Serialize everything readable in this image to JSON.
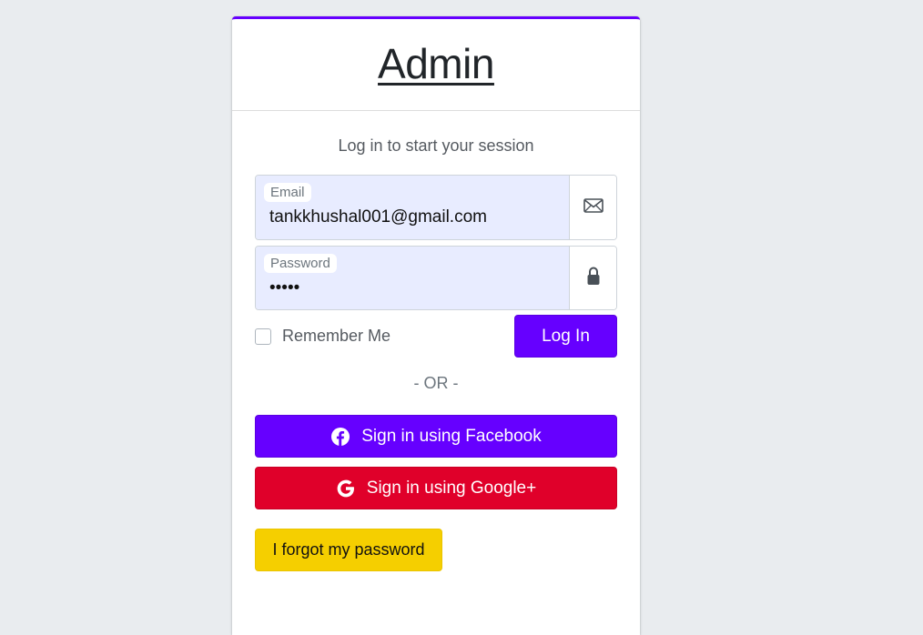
{
  "brand": {
    "title": "Admin"
  },
  "login_message": "Log in to start your session",
  "email": {
    "label": "Email",
    "value": "tankkhushal001@gmail.com",
    "icon": "envelope-icon"
  },
  "password": {
    "label": "Password",
    "value": "•••••",
    "icon": "lock-icon"
  },
  "remember_me": {
    "label": "Remember Me",
    "checked": false
  },
  "login_button": "Log In",
  "separator": "- OR -",
  "social": {
    "facebook_label": "Sign in using Facebook",
    "google_label": "Sign in using Google+"
  },
  "forgot_password": "I forgot my password",
  "colors": {
    "primary": "#6600ff",
    "danger": "#e0002a",
    "warning": "#f5cf00",
    "background": "#e9ecef",
    "autofill": "#e8ecff"
  }
}
